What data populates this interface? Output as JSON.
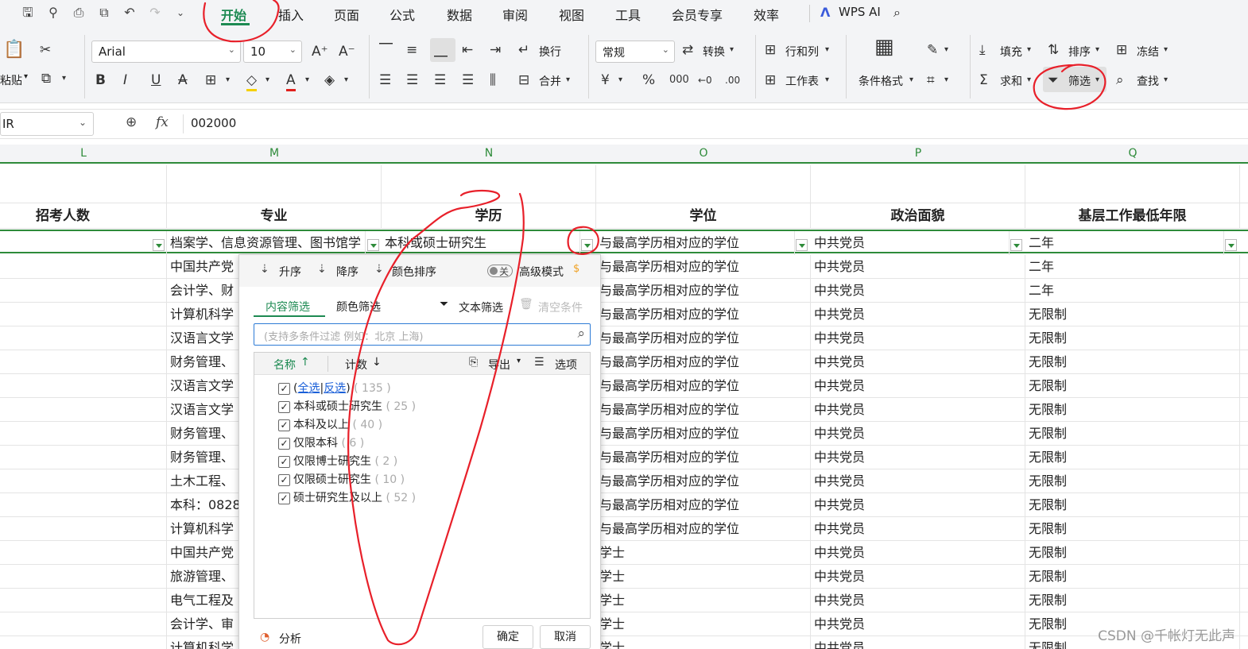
{
  "menu": {
    "items": [
      "开始",
      "插入",
      "页面",
      "公式",
      "数据",
      "审阅",
      "视图",
      "工具",
      "会员专享",
      "效率"
    ],
    "wps_ai": "WPS AI"
  },
  "ribbon": {
    "paste": "粘贴",
    "font_name": "Arial",
    "font_size": "10",
    "wrap": "换行",
    "merge": "合并",
    "number_format": "常规",
    "convert": "转换",
    "row_col": "行和列",
    "worksheet": "工作表",
    "cond_format": "条件格式",
    "fill": "填充",
    "sort": "排序",
    "freeze": "冻结",
    "sum": "求和",
    "filter": "筛选",
    "find": "查找"
  },
  "formula_bar": {
    "name_box": "IR",
    "fx": "fx",
    "value": "002000"
  },
  "columns": [
    "L",
    "M",
    "N",
    "O",
    "P",
    "Q"
  ],
  "header_row": [
    "招考人数",
    "专业",
    "学历",
    "学位",
    "政治面貌",
    "基层工作最低年限"
  ],
  "filter_row": [
    "",
    "档案学、信息资源管理、图书馆学",
    "本科或硕士研究生",
    "与最高学历相对应的学位",
    "中共党员",
    "二年"
  ],
  "rows": [
    [
      "中国共产党",
      "与最高学历相对应的学位",
      "中共党员",
      "二年"
    ],
    [
      "会计学、财",
      "与最高学历相对应的学位",
      "中共党员",
      "二年"
    ],
    [
      "计算机科学",
      "与最高学历相对应的学位",
      "中共党员",
      "无限制"
    ],
    [
      "汉语言文学",
      "与最高学历相对应的学位",
      "中共党员",
      "无限制"
    ],
    [
      "财务管理、",
      "与最高学历相对应的学位",
      "中共党员",
      "无限制"
    ],
    [
      "汉语言文学",
      "与最高学历相对应的学位",
      "中共党员",
      "无限制"
    ],
    [
      "汉语言文学",
      "与最高学历相对应的学位",
      "中共党员",
      "无限制"
    ],
    [
      "财务管理、",
      "与最高学历相对应的学位",
      "中共党员",
      "无限制"
    ],
    [
      "财务管理、",
      "与最高学历相对应的学位",
      "中共党员",
      "无限制"
    ],
    [
      "土木工程、",
      "与最高学历相对应的学位",
      "中共党员",
      "无限制"
    ],
    [
      "本科：0828",
      "与最高学历相对应的学位",
      "中共党员",
      "无限制"
    ],
    [
      "计算机科学",
      "与最高学历相对应的学位",
      "中共党员",
      "无限制"
    ],
    [
      "中国共产党",
      "学士",
      "中共党员",
      "无限制"
    ],
    [
      "旅游管理、",
      "学士",
      "中共党员",
      "无限制"
    ],
    [
      "电气工程及",
      "学士",
      "中共党员",
      "无限制"
    ],
    [
      "会计学、审",
      "学士",
      "中共党员",
      "无限制"
    ],
    [
      "计算机科学",
      "学士",
      "中共党员",
      "无限制"
    ]
  ],
  "popup": {
    "sort_asc": "升序",
    "sort_desc": "降序",
    "sort_color": "颜色排序",
    "toggle_off": "关",
    "advanced": "高级模式",
    "tab_content": "内容筛选",
    "tab_color": "颜色筛选",
    "text_filter": "文本筛选",
    "clear": "清空条件",
    "search_placeholder": "(支持多条件过滤  例如：北京  上海)",
    "col_name": "名称",
    "col_count": "计数",
    "export": "导出",
    "options": "选项",
    "select_all": "全选",
    "invert": "反选",
    "all_count": "135",
    "items": [
      {
        "label": "本科或硕士研究生",
        "count": "25"
      },
      {
        "label": "本科及以上",
        "count": "40"
      },
      {
        "label": "仅限本科",
        "count": "6"
      },
      {
        "label": "仅限博士研究生",
        "count": "2"
      },
      {
        "label": "仅限硕士研究生",
        "count": "10"
      },
      {
        "label": "硕士研究生及以上",
        "count": "52"
      }
    ],
    "analysis": "分析",
    "ok": "确定",
    "cancel": "取消"
  },
  "watermark": "CSDN @千帐灯无此声",
  "colors": {
    "accent": "#1d8a52",
    "annotation": "#e8202a"
  }
}
